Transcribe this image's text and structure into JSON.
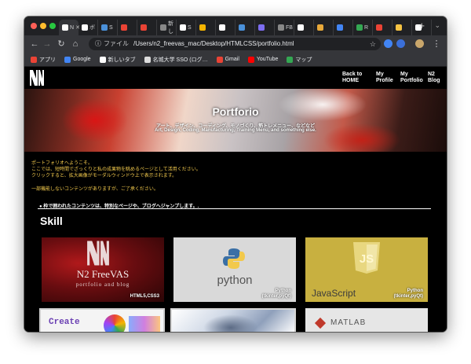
{
  "browser": {
    "tabs": [
      {
        "label": "N",
        "color": "#ffffff"
      },
      {
        "label": "ボ",
        "color": "#ffffff"
      },
      {
        "label": "S",
        "color": "#4a90d9"
      },
      {
        "label": "",
        "color": "#ea4335"
      },
      {
        "label": "",
        "color": "#ea4335"
      },
      {
        "label": "新し",
        "color": "#888888"
      },
      {
        "label": "S",
        "color": "#ffffff"
      },
      {
        "label": "",
        "color": "#f4b400"
      },
      {
        "label": "",
        "color": "#ffffff"
      },
      {
        "label": "",
        "color": "#4a90d9"
      },
      {
        "label": "",
        "color": "#7d6df0"
      },
      {
        "label": "FB",
        "color": "#888888"
      },
      {
        "label": "",
        "color": "#ffffff"
      },
      {
        "label": "",
        "color": "#e8a93a"
      },
      {
        "label": "",
        "color": "#4285f4"
      },
      {
        "label": "R",
        "color": "#34a853"
      },
      {
        "label": "",
        "color": "#ea4335"
      },
      {
        "label": "",
        "color": "#f6c343"
      },
      {
        "label": "",
        "color": "#ffffff"
      }
    ],
    "new_tab": "+",
    "address": {
      "scheme_label": "ファイル",
      "url": "/Users/n2_freevas_mac/Desktop/HTMLCSS/portfolio.html"
    },
    "bookmarks": [
      {
        "label": "アプリ",
        "icon": "apps-grid-icon",
        "color": "#ea4335"
      },
      {
        "label": "Google",
        "icon": "google-icon",
        "color": "#4285f4"
      },
      {
        "label": "新しいタブ",
        "icon": "triangle-icon",
        "color": "#ffffff"
      },
      {
        "label": "名城大学 SSO (ログ…",
        "icon": "sso-icon",
        "color": "#dddddd"
      },
      {
        "label": "Gmail",
        "icon": "gmail-icon",
        "color": "#ea4335"
      },
      {
        "label": "YouTube",
        "icon": "youtube-icon",
        "color": "#ff0000"
      },
      {
        "label": "マップ",
        "icon": "maps-icon",
        "color": "#34a853"
      }
    ]
  },
  "site": {
    "logo_text": "N",
    "nav": [
      {
        "line1": "Back to",
        "line2": "HOME"
      },
      {
        "line1": "My",
        "line2": "Profile"
      },
      {
        "line1": "My",
        "line2": "Portfolio"
      },
      {
        "line1": "N2",
        "line2": "Blog"
      }
    ],
    "hero": {
      "title": "Portforio",
      "subtitle_jp": "アート、デザイン、コーディング、モノづくり、筋トレメニュー、などなど",
      "subtitle_en": "Art, Design, Coding, Manufacturing, Training Menu, and something else."
    },
    "intro": [
      "ポートフォリオへようこそ。",
      "ここでは、短時間でざっくりと私の成果物を眺めるページとして活用ください。",
      "クリックすると、拡大画像がモーダルウィンドウ上で表示されます。",
      "一部機能しないコンテンツがありますが、ご了承ください。"
    ],
    "notice": "● 枠で囲われたコンテンツは、特別なページや、ブログへジャンプします。.",
    "skill_heading": "Skill",
    "cards": [
      {
        "brand_line1": "N2 FreeVAS",
        "brand_line2": "portfolio and blog",
        "caption": "HTML5,CSS3"
      },
      {
        "logo_text": "python",
        "caption_line1": "Python",
        "caption_line2": "(tkinter,pyQt)"
      },
      {
        "logo_text": "JavaScript",
        "logo_mark": "JS",
        "caption_line1": "Python",
        "caption_line2": "(tkinter,pyQt)"
      },
      {
        "logo_text": "Create"
      },
      {
        "logo_text": ""
      },
      {
        "logo_text": "MATLAB"
      }
    ],
    "colors": {
      "accent_text": "#f2c94c",
      "background": "#000000"
    }
  }
}
